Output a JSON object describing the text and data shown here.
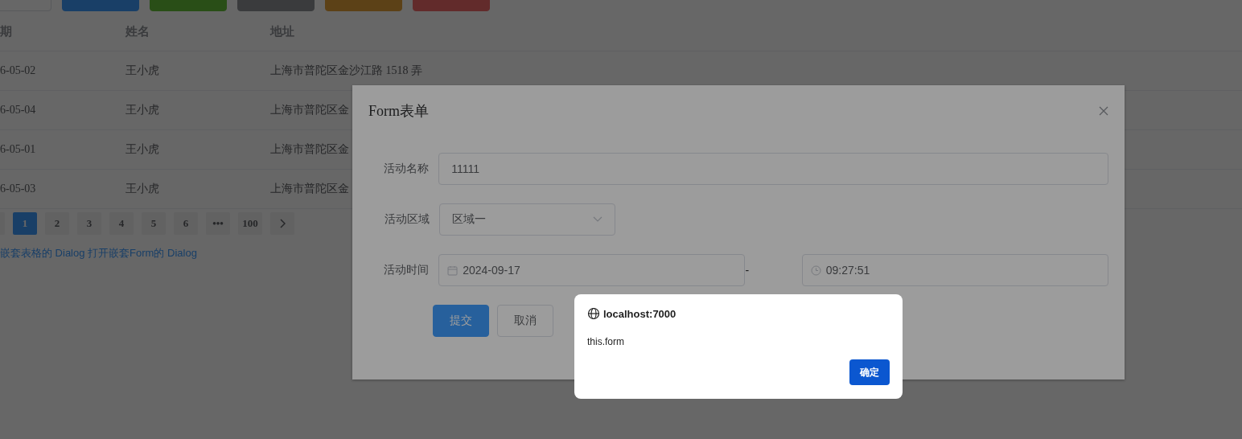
{
  "top_buttons": [
    {
      "kind": "default"
    },
    {
      "kind": "primary"
    },
    {
      "kind": "success"
    },
    {
      "kind": "info"
    },
    {
      "kind": "warning"
    },
    {
      "kind": "danger"
    }
  ],
  "table": {
    "columns": [
      "期",
      "姓名",
      "地址"
    ],
    "rows": [
      {
        "cells": [
          "6-05-02",
          "王小虎",
          "上海市普陀区金沙江路 1518 弄"
        ]
      },
      {
        "cells": [
          "6-05-04",
          "王小虎",
          "上海市普陀区金"
        ]
      },
      {
        "cells": [
          "6-05-01",
          "王小虎",
          "上海市普陀区金"
        ]
      },
      {
        "cells": [
          "6-05-03",
          "王小虎",
          "上海市普陀区金"
        ]
      }
    ]
  },
  "pagination": {
    "pages": [
      {
        "label": "1",
        "selected": true
      },
      {
        "label": "2",
        "selected": false
      },
      {
        "label": "3",
        "selected": false
      },
      {
        "label": "4",
        "selected": false
      },
      {
        "label": "5",
        "selected": false
      },
      {
        "label": "6",
        "selected": false
      },
      {
        "label": "•••",
        "selected": false
      },
      {
        "label": "100",
        "selected": false
      }
    ]
  },
  "link": "嵌套表格的 Dialog 打开嵌套Form的 Dialog",
  "dialog": {
    "title": "Form表单",
    "fields": [
      {
        "kind": "input",
        "label": "活动名称",
        "value": "11111"
      },
      {
        "kind": "select",
        "label": "活动区域",
        "value": "区域一"
      },
      {
        "kind": "datetime",
        "label": "活动时间",
        "date": "2024-09-17",
        "separator": "-",
        "time": "09:27:51"
      }
    ],
    "buttons": [
      {
        "kind": "primary",
        "label": "提交"
      },
      {
        "kind": "default",
        "label": "取消"
      }
    ]
  },
  "alert": {
    "title": "localhost:7000",
    "message": "this.form",
    "button": "确定"
  }
}
